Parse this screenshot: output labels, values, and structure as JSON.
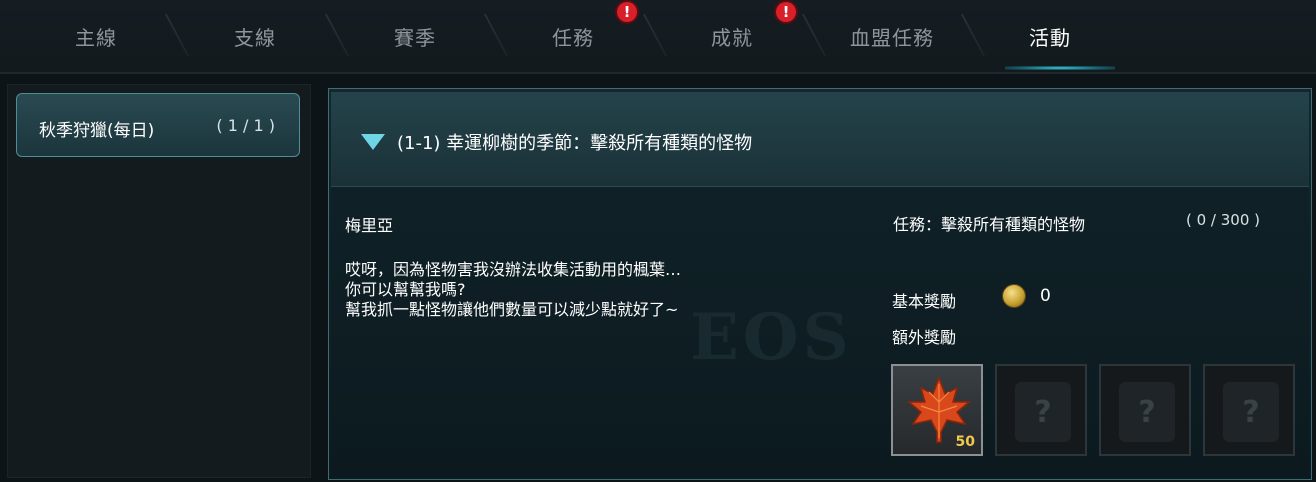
{
  "tabs": [
    {
      "label": "主線",
      "alert": false,
      "active": false
    },
    {
      "label": "支線",
      "alert": false,
      "active": false
    },
    {
      "label": "賽季",
      "alert": false,
      "active": false
    },
    {
      "label": "任務",
      "alert": true,
      "active": false
    },
    {
      "label": "成就",
      "alert": true,
      "active": false
    },
    {
      "label": "血盟任務",
      "alert": false,
      "active": false
    },
    {
      "label": "活動",
      "alert": false,
      "active": true
    }
  ],
  "alert_symbol": "!",
  "sidebar": {
    "items": [
      {
        "name": "秋季狩獵(每日)",
        "count": "( 1 / 1 )",
        "selected": true
      }
    ]
  },
  "quest": {
    "title": "(1-1) 幸運柳樹的季節：擊殺所有種類的怪物",
    "npc": "梅里亞",
    "dialogue": [
      "哎呀，因為怪物害我沒辦法收集活動用的楓葉…",
      "你可以幫幫我嗎?",
      "幫我抓一點怪物讓他們數量可以減少點就好了~"
    ],
    "task_label": "任務：擊殺所有種類的怪物",
    "task_progress": "( 0 / 300 )",
    "basic_reward_label": "基本獎勵",
    "basic_reward_icon": "gold-coin-icon",
    "basic_reward_amount": "0",
    "extra_reward_label": "額外獎勵",
    "extra_rewards": [
      {
        "icon": "maple-leaf-icon",
        "quantity": "50",
        "locked": false
      },
      {
        "icon": "mystery-gift-icon",
        "quantity": "",
        "locked": true
      },
      {
        "icon": "mystery-gift-icon",
        "quantity": "",
        "locked": true
      },
      {
        "icon": "mystery-gift-icon",
        "quantity": "",
        "locked": true
      }
    ]
  },
  "colors": {
    "accent": "#3fd0e0",
    "alert": "#d8202a",
    "quantity": "#f2c94c"
  }
}
